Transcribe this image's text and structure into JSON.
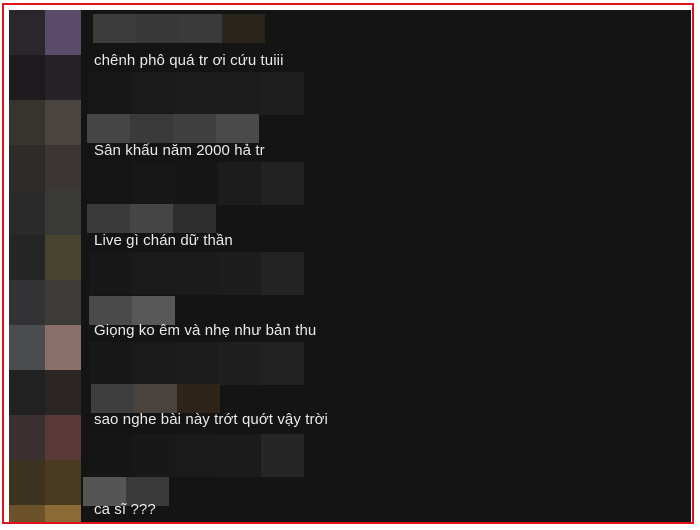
{
  "comments": [
    {
      "text": "chênh phô quá tr ơi cứu tuiii"
    },
    {
      "text": "Sân khấu năm 2000 hả tr"
    },
    {
      "text": "Live gì chán dữ thần"
    },
    {
      "text": "Giọng ko êm và nhẹ như bản thu"
    },
    {
      "text": "sao nghe bài này trớt quớt vậy trời"
    },
    {
      "text": "ca sĩ ???"
    }
  ],
  "colors": {
    "border": "#e0121b",
    "panel": "#141414",
    "text": "#eaeaea"
  }
}
